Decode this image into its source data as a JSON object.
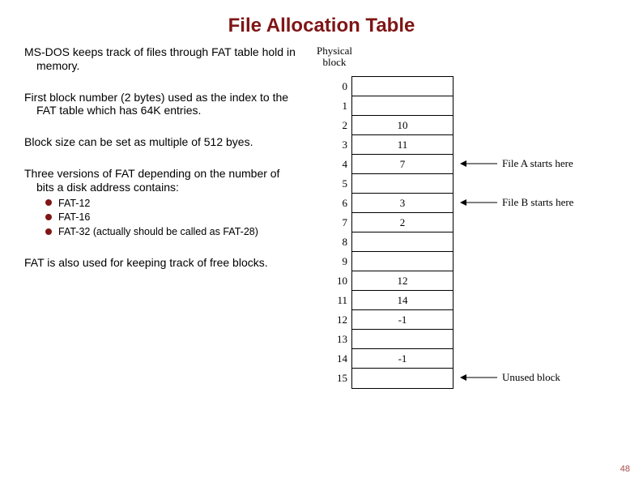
{
  "title": "File Allocation Table",
  "paragraphs": {
    "p1": "MS-DOS keeps track of files through FAT table hold in memory.",
    "p2": "First block number (2 bytes) used as the index to the FAT table which has 64K entries.",
    "p3": "Block size can be set as multiple of 512 byes.",
    "p4": "Three versions of FAT depending on the number of bits a disk address contains:",
    "p5": "FAT is also used for keeping track of free blocks."
  },
  "bullets": {
    "b1": "FAT-12",
    "b2": "FAT-16",
    "b3": "FAT-32  (actually should be called as FAT-28)"
  },
  "diagram": {
    "header": "Physical block",
    "rows": [
      {
        "idx": "0",
        "val": ""
      },
      {
        "idx": "1",
        "val": ""
      },
      {
        "idx": "2",
        "val": "10"
      },
      {
        "idx": "3",
        "val": "11"
      },
      {
        "idx": "4",
        "val": "7"
      },
      {
        "idx": "5",
        "val": ""
      },
      {
        "idx": "6",
        "val": "3"
      },
      {
        "idx": "7",
        "val": "2"
      },
      {
        "idx": "8",
        "val": ""
      },
      {
        "idx": "9",
        "val": ""
      },
      {
        "idx": "10",
        "val": "12"
      },
      {
        "idx": "11",
        "val": "14"
      },
      {
        "idx": "12",
        "val": "-1"
      },
      {
        "idx": "13",
        "val": ""
      },
      {
        "idx": "14",
        "val": "-1"
      },
      {
        "idx": "15",
        "val": ""
      }
    ],
    "annotations": {
      "a4": "File A starts here",
      "a6": "File B starts here",
      "a15": "Unused block"
    }
  },
  "page_number": "48"
}
